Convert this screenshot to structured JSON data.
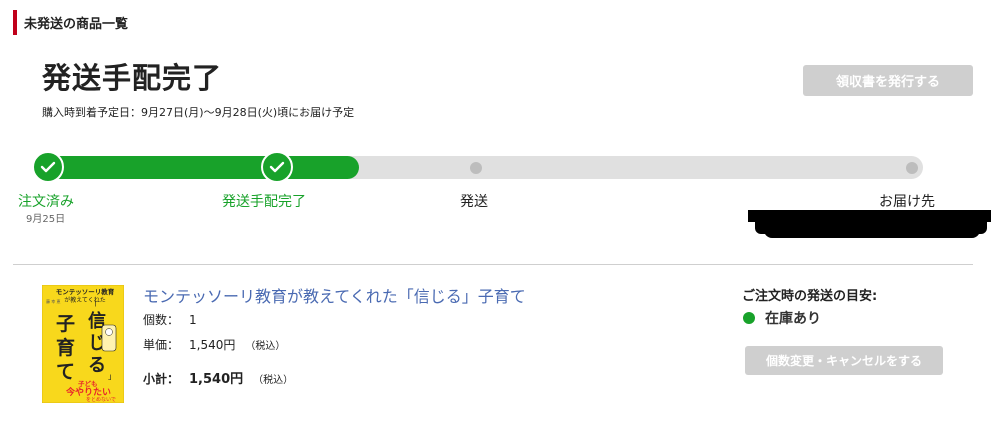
{
  "section": {
    "title": "未発送の商品一覧"
  },
  "order": {
    "status_title": "発送手配完了",
    "delivery_note": "購入時到着予定日：9月27日(月)～9月28日(火)頃にお届け予定",
    "receipt_button_label": "領収書を発行する"
  },
  "progress": {
    "steps": [
      {
        "label": "注文済み",
        "date": "9月25日",
        "state": "done"
      },
      {
        "label": "発送手配完了",
        "state": "done"
      },
      {
        "label": "発送",
        "state": "pending"
      },
      {
        "label": "お届け先",
        "state": "pending"
      }
    ]
  },
  "product": {
    "title": "モンテッソーリ教育が教えてくれた「信じる」子育て",
    "quantity_label": "個数：",
    "quantity_value": "1",
    "unit_price_label": "単価：",
    "unit_price_value": "1,540円",
    "unit_price_tax": "（税込）",
    "subtotal_label": "小計：",
    "subtotal_value": "1,540円",
    "subtotal_tax": "（税込）",
    "cover": {
      "headline": "モンテッソーリ教育",
      "subheadline": "が教えてくれた",
      "big_chars_left": [
        "子",
        "育",
        "て"
      ],
      "big_chars_right": [
        "信",
        "じ",
        "る"
      ],
      "bracket_open": "「",
      "bracket_close": "」",
      "author": "藤 幸 恵",
      "tagline_1": "子ども",
      "tagline_2": "今やりたい",
      "tagline_3": "をとめないで",
      "colors": {
        "background": "#f8d81c",
        "text": "#222222",
        "accent": "#e8262a"
      }
    }
  },
  "shipping": {
    "heading": "ご注文時の発送の目安:",
    "stock_status": "在庫あり",
    "stock_color": "#18a22a",
    "cancel_button_label": "個数変更・キャンセルをする"
  },
  "colors": {
    "accent_green": "#18a22a",
    "track_gray": "#e0e0e0",
    "link_blue": "#4a6ab2",
    "header_red": "#c0001a",
    "disabled_button": "#cfcfcf"
  }
}
